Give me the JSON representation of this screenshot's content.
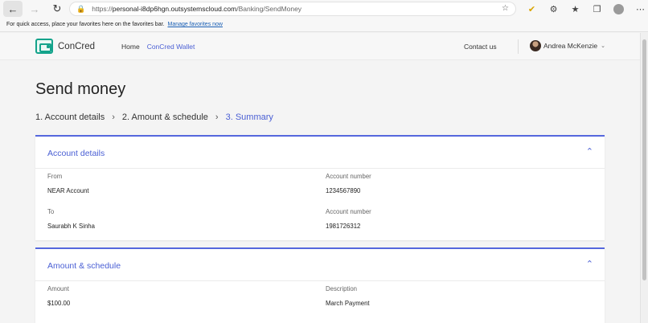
{
  "browser": {
    "url_prefix": "https://",
    "url_host": "personal-i8dp6hgn.outsystemscloud.com",
    "url_path": "/Banking/SendMoney",
    "favbar_text": "For quick access, place your favorites here on the favorites bar.",
    "favbar_link": "Manage favorites now"
  },
  "header": {
    "brand": "ConCred",
    "nav_home": "Home",
    "nav_wallet": "ConCred Wallet",
    "contact": "Contact us",
    "user_name": "Andrea McKenzie"
  },
  "page": {
    "title": "Send money",
    "steps": [
      "1. Account details",
      "2. Amount & schedule",
      "3. Summary"
    ]
  },
  "account_details": {
    "title": "Account details",
    "from_label": "From",
    "from_value": "NEAR Account",
    "from_acct_label": "Account number",
    "from_acct_value": "1234567890",
    "to_label": "To",
    "to_value": "Saurabh K Sinha",
    "to_acct_label": "Account number",
    "to_acct_value": "1981726312"
  },
  "amount_schedule": {
    "title": "Amount & schedule",
    "amount_label": "Amount",
    "amount_value": "$100.00",
    "description_label": "Description",
    "description_value": "March Payment"
  },
  "icons": {
    "back": "back-arrow-icon",
    "forward": "forward-arrow-icon",
    "refresh": "refresh-icon",
    "lock": "lock-icon",
    "chevron_up": "chevron-up-icon"
  },
  "colors": {
    "accent": "#4a5fd4",
    "brand": "#14a38b"
  }
}
